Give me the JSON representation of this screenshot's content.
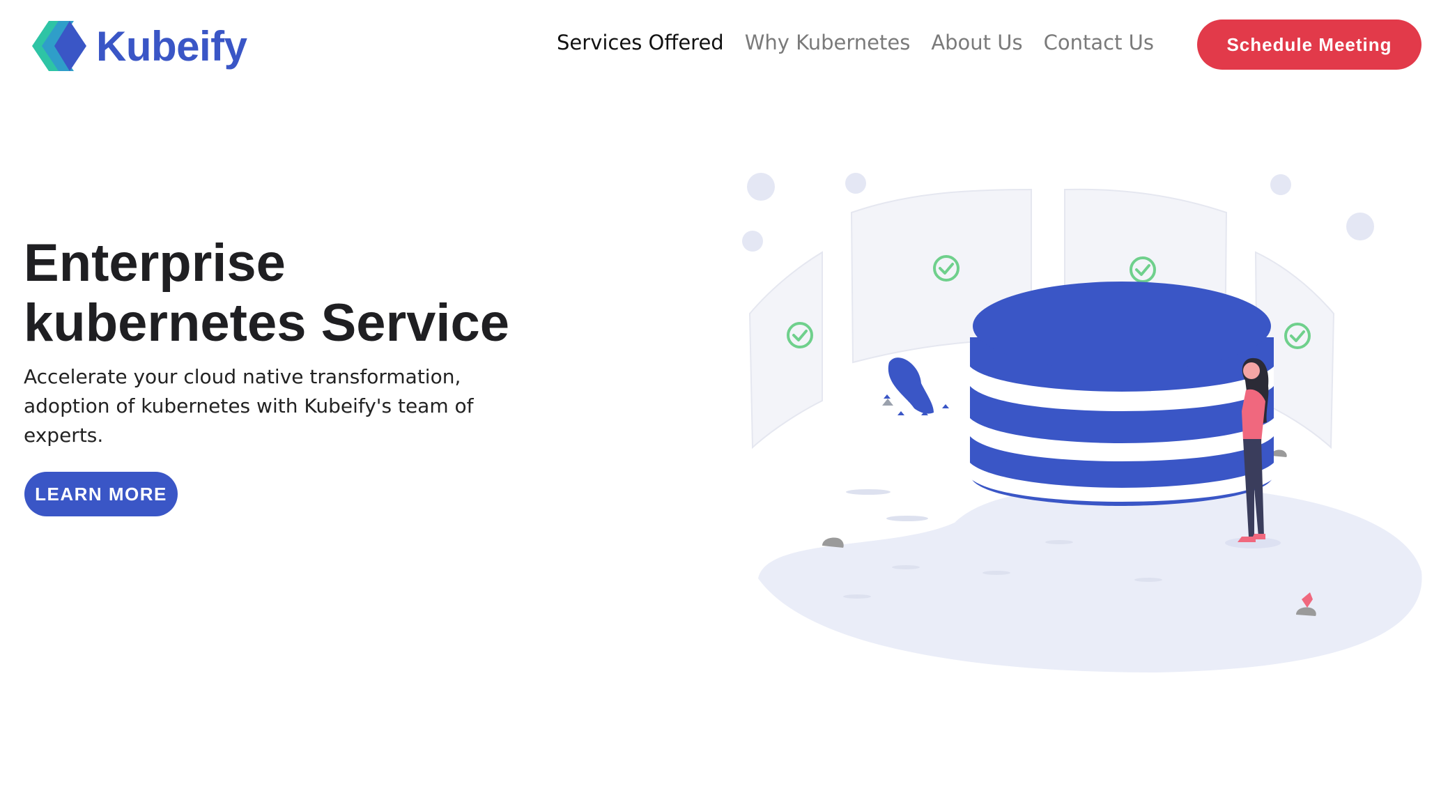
{
  "brand": {
    "name": "Kubeify",
    "color": "#3a56c6",
    "accent": "#2ec4a5"
  },
  "nav": {
    "items": [
      {
        "label": "Services Offered",
        "active": true
      },
      {
        "label": "Why Kubernetes",
        "active": false
      },
      {
        "label": "About Us",
        "active": false
      },
      {
        "label": "Contact Us",
        "active": false
      }
    ],
    "cta": {
      "label": "Schedule Meeting",
      "color": "#e23a4a"
    }
  },
  "hero": {
    "title_line1": "Enterprise",
    "title_line2": "kubernetes Service",
    "subtitle": "Accelerate your cloud native transformation, adoption of kubernetes with Kubeify's team of experts.",
    "button": "LEARN MORE"
  },
  "illustration": {
    "subject": "database-with-person",
    "primary_color": "#3a56c6",
    "check_color": "#6fd08c",
    "person_top_color": "#f0687e"
  }
}
